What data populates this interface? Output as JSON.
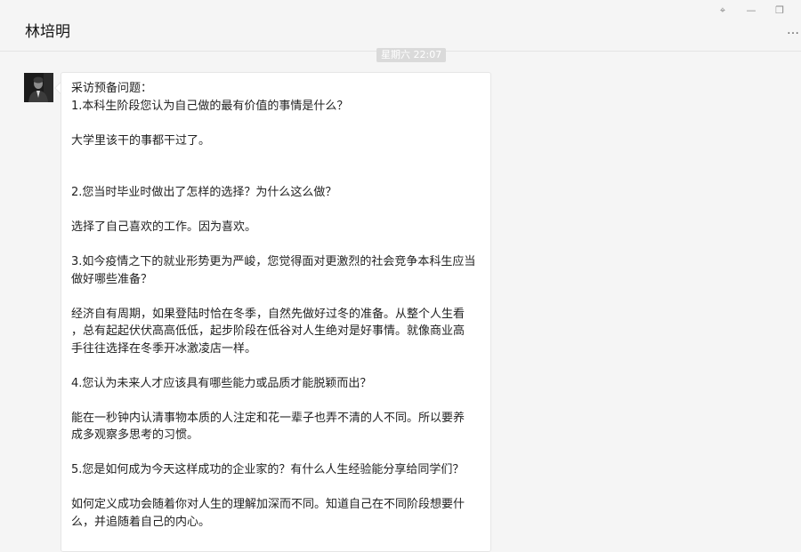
{
  "header": {
    "title": "林培明",
    "pin_glyph": "⌖",
    "minimize_glyph": "—",
    "restore_glyph": "❐",
    "more_glyph": "…"
  },
  "chat": {
    "timestamp": "星期六 22:07",
    "message": {
      "lines": [
        "采访预备问题：",
        "1.本科生阶段您认为自己做的最有价值的事情是什么？",
        "",
        "大学里该干的事都干过了。",
        "",
        "",
        "2.您当时毕业时做出了怎样的选择？为什么这么做？",
        "",
        "选择了自己喜欢的工作。因为喜欢。",
        "",
        "3.如今疫情之下的就业形势更为严峻，您觉得面对更激烈的社会竞争本科生应当",
        "做好哪些准备？",
        "",
        "经济自有周期，如果登陆时恰在冬季，自然先做好过冬的准备。从整个人生看",
        "，总有起起伏伏高高低低，起步阶段在低谷对人生绝对是好事情。就像商业高",
        "手往往选择在冬季开冰激凌店一样。",
        "",
        "4.您认为未来人才应该具有哪些能力或品质才能脱颖而出？",
        "",
        "能在一秒钟内认清事物本质的人注定和花一辈子也弄不清的人不同。所以要养",
        "成多观察多思考的习惯。",
        "",
        "5.您是如何成为今天这样成功的企业家的？有什么人生经验能分享给同学们？",
        "",
        "如何定义成功会随着你对人生的理解加深而不同。知道自己在不同阶段想要什",
        "么，并追随着自己的内心。"
      ]
    }
  },
  "colors": {
    "background": "#f5f5f5",
    "bubble": "#ffffff",
    "timestamp_bg": "#dadada"
  }
}
